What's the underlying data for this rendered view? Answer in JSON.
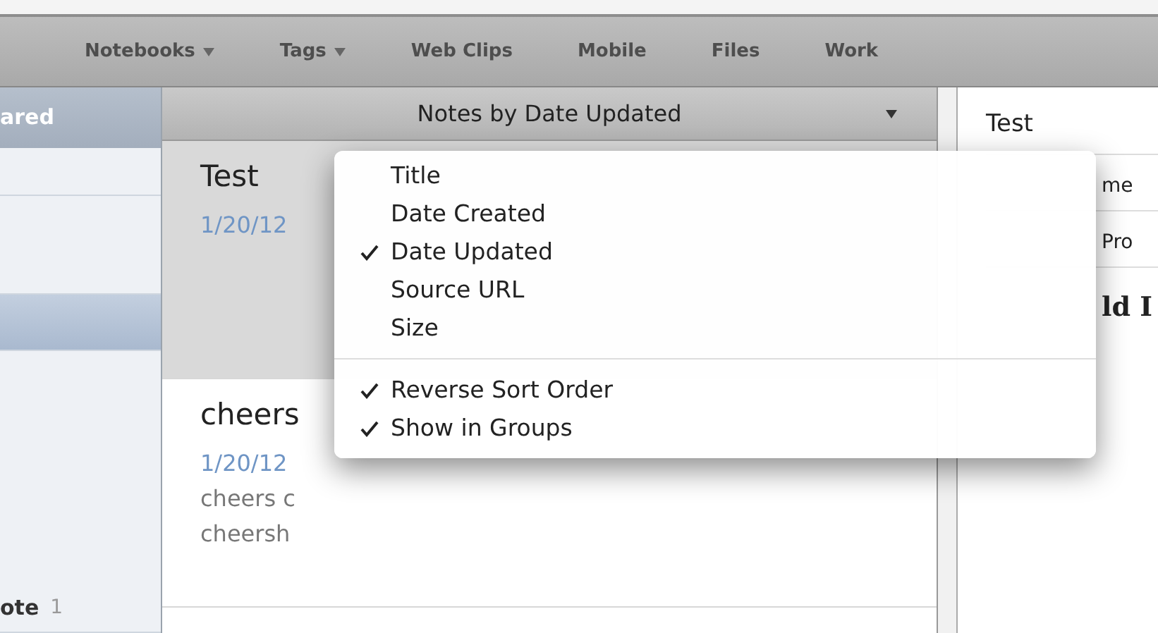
{
  "toolbar": {
    "tabs": [
      {
        "label": "Notebooks",
        "has_menu": true
      },
      {
        "label": "Tags",
        "has_menu": true
      },
      {
        "label": "Web Clips",
        "has_menu": false
      },
      {
        "label": "Mobile",
        "has_menu": false
      },
      {
        "label": "Files",
        "has_menu": false
      },
      {
        "label": "Work",
        "has_menu": false
      }
    ]
  },
  "sidebar": {
    "header": "ared",
    "items": [
      {
        "selected": false
      },
      {
        "selected": false
      },
      {
        "selected": true
      },
      {
        "label": "ote",
        "count": "1",
        "selected": false
      }
    ]
  },
  "note_list": {
    "header": "Notes by Date Updated",
    "notes": [
      {
        "title": "Test",
        "date": "1/20/12",
        "selected": true
      },
      {
        "title": "cheers",
        "date": "1/20/12",
        "snippet_lines": [
          "cheers c",
          "cheersh"
        ],
        "selected": false
      }
    ]
  },
  "sort_menu": {
    "sections": [
      [
        {
          "label": "Title",
          "checked": false
        },
        {
          "label": "Date Created",
          "checked": false
        },
        {
          "label": "Date Updated",
          "checked": true
        },
        {
          "label": "Source URL",
          "checked": false
        },
        {
          "label": "Size",
          "checked": false
        }
      ],
      [
        {
          "label": "Reverse Sort Order",
          "checked": true
        },
        {
          "label": "Show in Groups",
          "checked": true
        }
      ]
    ]
  },
  "note_pane": {
    "title": "Test",
    "fields": [
      "me",
      "Pro"
    ],
    "body": "ld I"
  }
}
